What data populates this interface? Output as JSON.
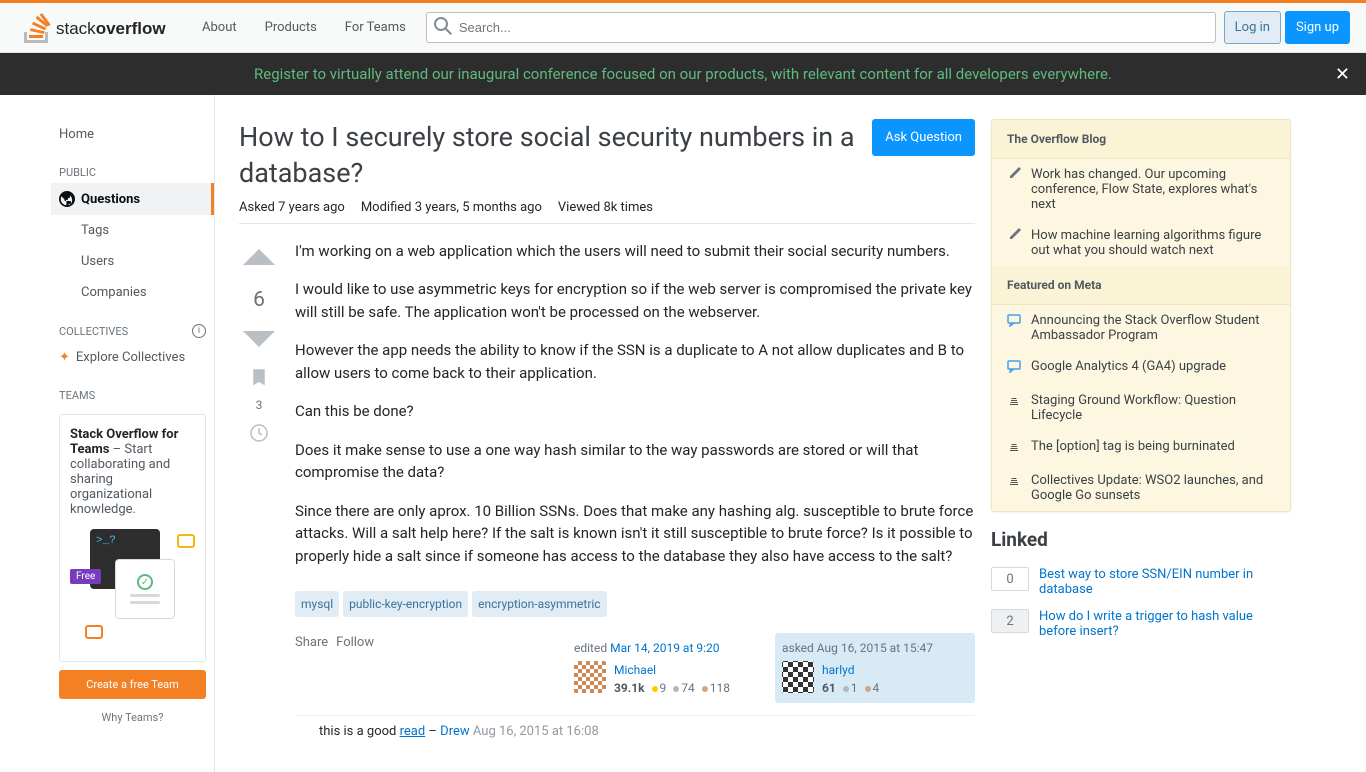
{
  "header": {
    "nav": {
      "about": "About",
      "products": "Products",
      "for_teams": "For Teams"
    },
    "search_placeholder": "Search...",
    "login": "Log in",
    "signup": "Sign up"
  },
  "banner": {
    "text": "Register to virtually attend our inaugural conference focused on our products, with relevant content for all developers everywhere."
  },
  "sidebar": {
    "home": "Home",
    "public": "PUBLIC",
    "questions": "Questions",
    "tags": "Tags",
    "users": "Users",
    "companies": "Companies",
    "collectives": "COLLECTIVES",
    "explore_collectives": "Explore Collectives",
    "teams": "TEAMS",
    "teams_promo_strong": "Stack Overflow for Teams",
    "teams_promo_text": " – Start collaborating and sharing organizational knowledge.",
    "free_badge": "Free",
    "create_team": "Create a free Team",
    "why_teams": "Why Teams?"
  },
  "question": {
    "title": "How to I securely store social security numbers in a database?",
    "ask_button": "Ask Question",
    "asked_label": "Asked",
    "asked_value": "7 years ago",
    "modified_label": "Modified",
    "modified_value": "3 years, 5 months ago",
    "viewed_label": "Viewed",
    "viewed_value": "8k times",
    "vote_count": "6",
    "bookmark_count": "3",
    "body": {
      "p1": "I'm working on a web application which the users will need to submit their social security numbers.",
      "p2": "I would like to use asymmetric keys for encryption so if the web server is compromised the private key will still be safe. The application won't be processed on the webserver.",
      "p3": "However the app needs the ability to know if the SSN is a duplicate to A not allow duplicates and B to allow users to come back to their application.",
      "p4": "Can this be done?",
      "p5": "Does it make sense to use a one way hash similar to the way passwords are stored or will that compromise the data?",
      "p6": "Since there are only aprox. 10 Billion SSNs. Does that make any hashing alg. susceptible to brute force attacks. Will a salt help here? If the salt is known isn't it still susceptible to brute force? Is it possible to properly hide a salt since if someone has access to the database they also have access to the salt?"
    },
    "tags": [
      "mysql",
      "public-key-encryption",
      "encryption-asymmetric"
    ],
    "actions": {
      "share": "Share",
      "follow": "Follow"
    },
    "editor": {
      "action": "edited ",
      "time": "Mar 14, 2019 at 9:20",
      "name": "Michael",
      "rep": "39.1k",
      "gold": "9",
      "silver": "74",
      "bronze": "118"
    },
    "asker": {
      "action": "asked ",
      "time": "Aug 16, 2015 at 15:47",
      "name": "harlyd",
      "rep": "61",
      "silver": "1",
      "bronze": "4"
    },
    "comment": {
      "text_before": "this is a good ",
      "link": "read",
      "dash": " – ",
      "author": "Drew",
      "time": " Aug 16, 2015 at 16:08"
    }
  },
  "right": {
    "blog_header": "The Overflow Blog",
    "blog_items": [
      "Work has changed. Our upcoming conference, Flow State, explores what's next",
      "How machine learning algorithms figure out what you should watch next"
    ],
    "meta_header": "Featured on Meta",
    "meta_items": [
      "Announcing the Stack Overflow Student Ambassador Program",
      "Google Analytics 4 (GA4) upgrade",
      "Staging Ground Workflow: Question Lifecycle",
      "The [option] tag is being burninated",
      "Collectives Update: WSO2 launches, and Google Go sunsets"
    ],
    "linked_header": "Linked",
    "linked_items": [
      {
        "score": "0",
        "title": "Best way to store SSN/EIN number in database"
      },
      {
        "score": "2",
        "title": "How do I write a trigger to hash value before insert?"
      }
    ]
  }
}
